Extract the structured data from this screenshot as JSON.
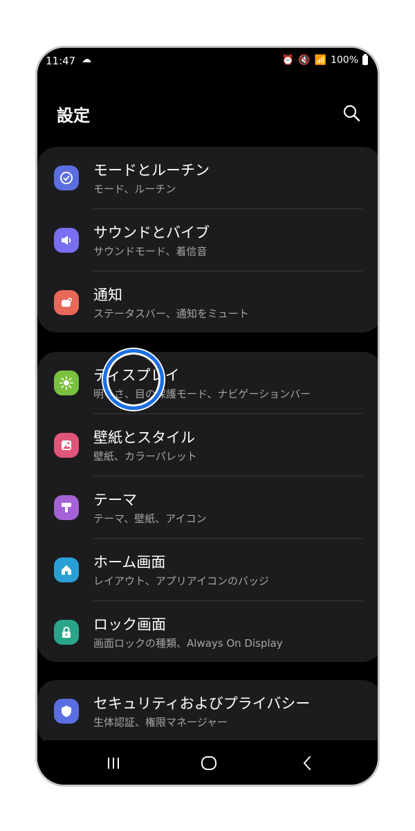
{
  "status_bar": {
    "time": "11:47",
    "battery": "100%"
  },
  "header": {
    "title": "設定"
  },
  "groups": [
    {
      "items": [
        {
          "title": "モードとルーチン",
          "subtitle": "モード、ルーチン",
          "icon": "modes-routines-icon",
          "color": "#5b6ee1"
        },
        {
          "title": "サウンドとバイブ",
          "subtitle": "サウンドモード、着信音",
          "icon": "sound-icon",
          "color": "#7a6ff0"
        },
        {
          "title": "通知",
          "subtitle": "ステータスバー、通知をミュート",
          "icon": "notifications-icon",
          "color": "#e8685a"
        }
      ]
    },
    {
      "items": [
        {
          "title": "ディスプレイ",
          "subtitle": "明るさ、目の保護モード、ナビゲーションバー",
          "icon": "display-icon",
          "color": "#7ac13f"
        },
        {
          "title": "壁紙とスタイル",
          "subtitle": "壁紙、カラーパレット",
          "icon": "wallpaper-icon",
          "color": "#e0557a"
        },
        {
          "title": "テーマ",
          "subtitle": "テーマ、壁紙、アイコン",
          "icon": "themes-icon",
          "color": "#a462d6"
        },
        {
          "title": "ホーム画面",
          "subtitle": "レイアウト、アプリアイコンのバッジ",
          "icon": "home-icon",
          "color": "#2a9fd6"
        },
        {
          "title": "ロック画面",
          "subtitle": "画面ロックの種類、Always On Display",
          "icon": "lock-icon",
          "color": "#2aa58a"
        }
      ]
    },
    {
      "items": [
        {
          "title": "セキュリティおよびプライバシー",
          "subtitle": "生体認証、権限マネージャー",
          "icon": "security-icon",
          "color": "#5b6ee1"
        }
      ]
    }
  ],
  "navbar": {
    "recents": "recents-icon",
    "home": "home-nav-icon",
    "back": "back-icon"
  }
}
